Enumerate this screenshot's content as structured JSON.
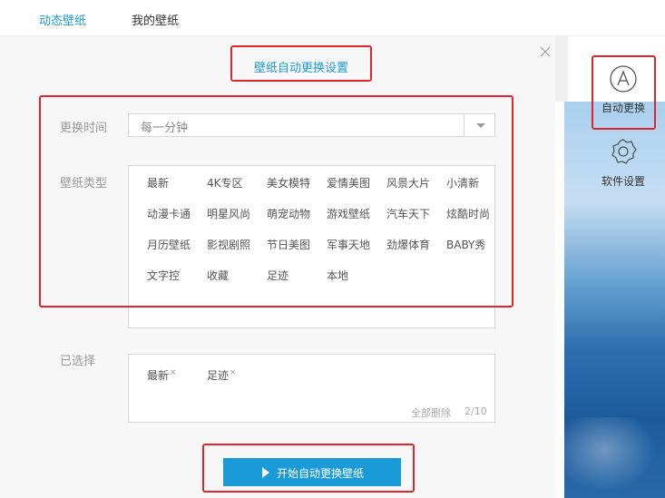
{
  "tabs": [
    {
      "label": "动态壁纸",
      "active": true
    },
    {
      "label": "我的壁纸",
      "active": false
    }
  ],
  "panel": {
    "title": "壁纸自动更换设置",
    "interval_label": "更换时间",
    "interval_value": "每一分钟",
    "type_label": "壁纸类型",
    "categories": [
      "最新",
      "4K专区",
      "美女模特",
      "爱情美图",
      "风景大片",
      "小清新",
      "动漫卡通",
      "明星风尚",
      "萌宠动物",
      "游戏壁纸",
      "汽车天下",
      "炫酷时尚",
      "月历壁纸",
      "影视剧照",
      "节日美图",
      "军事天地",
      "劲爆体育",
      "BABY秀",
      "文字控",
      "收藏",
      "足迹",
      "本地"
    ],
    "selected_label": "已选择",
    "selected": [
      "最新",
      "足迹"
    ],
    "remove_glyph": "×",
    "clear_all": "全部删除",
    "count": "2/10",
    "start_button": "开始自动更换壁纸"
  },
  "sidebar": {
    "auto_change": "自动更换",
    "software_settings": "软件设置"
  },
  "colors": {
    "accent": "#1a9bd7",
    "highlight": "#e0262b"
  }
}
